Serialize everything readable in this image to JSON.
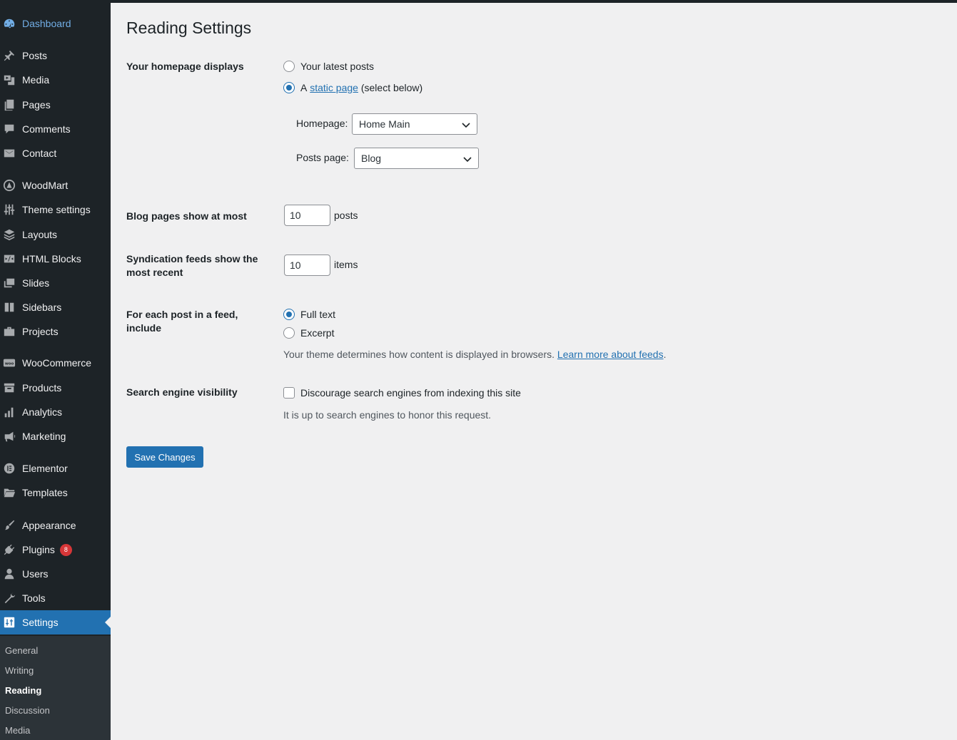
{
  "sidebar": {
    "items": [
      {
        "label": "Dashboard",
        "icon": "dashboard-icon"
      },
      {
        "label": "Posts",
        "icon": "pin-icon"
      },
      {
        "label": "Media",
        "icon": "media-icon"
      },
      {
        "label": "Pages",
        "icon": "pages-icon"
      },
      {
        "label": "Comments",
        "icon": "comment-icon"
      },
      {
        "label": "Contact",
        "icon": "mail-icon"
      },
      {
        "label": "WoodMart",
        "icon": "woodmart-icon"
      },
      {
        "label": "Theme settings",
        "icon": "sliders-icon"
      },
      {
        "label": "Layouts",
        "icon": "layers-icon"
      },
      {
        "label": "HTML Blocks",
        "icon": "code-icon"
      },
      {
        "label": "Slides",
        "icon": "slides-icon"
      },
      {
        "label": "Sidebars",
        "icon": "sidebar-icon"
      },
      {
        "label": "Projects",
        "icon": "briefcase-icon"
      },
      {
        "label": "WooCommerce",
        "icon": "woo-icon"
      },
      {
        "label": "Products",
        "icon": "archive-icon"
      },
      {
        "label": "Analytics",
        "icon": "bar-chart-icon"
      },
      {
        "label": "Marketing",
        "icon": "megaphone-icon"
      },
      {
        "label": "Elementor",
        "icon": "elementor-icon"
      },
      {
        "label": "Templates",
        "icon": "folder-icon"
      },
      {
        "label": "Appearance",
        "icon": "brush-icon"
      },
      {
        "label": "Plugins",
        "icon": "plug-icon",
        "badge": "8"
      },
      {
        "label": "Users",
        "icon": "user-icon"
      },
      {
        "label": "Tools",
        "icon": "wrench-icon"
      },
      {
        "label": "Settings",
        "icon": "settings-icon"
      }
    ],
    "submenu": [
      "General",
      "Writing",
      "Reading",
      "Discussion",
      "Media"
    ]
  },
  "page": {
    "title": "Reading Settings",
    "homepage_displays": {
      "label": "Your homepage displays",
      "option_latest": "Your latest posts",
      "option_static_prefix": "A",
      "option_static_link": "static page",
      "option_static_suffix": "(select below)",
      "selected": "static",
      "homepage_label": "Homepage:",
      "homepage_value": "Home Main",
      "posts_page_label": "Posts page:",
      "posts_page_value": "Blog"
    },
    "blog_pages": {
      "label": "Blog pages show at most",
      "value": "10",
      "unit": "posts"
    },
    "syndication": {
      "label_line1": "Syndication feeds show the",
      "label_line2": "most recent",
      "value": "10",
      "unit": "items"
    },
    "feed_include": {
      "label_line1": "For each post in a feed,",
      "label_line2": "include",
      "option_full": "Full text",
      "option_excerpt": "Excerpt",
      "selected": "full",
      "desc_text": "Your theme determines how content is displayed in browsers.",
      "desc_link": "Learn more about feeds",
      "desc_end": "."
    },
    "search_visibility": {
      "label": "Search engine visibility",
      "checkbox_label": "Discourage search engines from indexing this site",
      "checked": false,
      "desc": "It is up to search engines to honor this request."
    },
    "save_label": "Save Changes"
  },
  "colors": {
    "sidebar_bg": "#1d2327",
    "accent": "#2271b1",
    "badge": "#d63638",
    "page_bg": "#f0f0f1"
  }
}
